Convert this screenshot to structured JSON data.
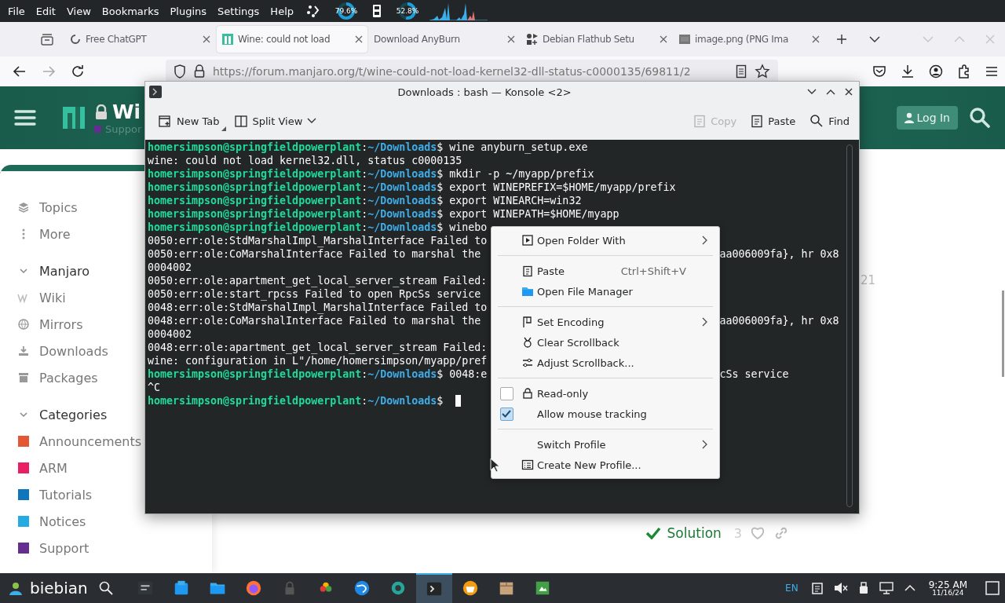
{
  "menubar": {
    "items": [
      "File",
      "Edit",
      "View",
      "Bookmarks",
      "Plugins",
      "Settings",
      "Help"
    ],
    "gauges": [
      {
        "reading": "79.6%",
        "level": 0.8
      },
      {
        "reading": "52.8%",
        "level": 0.53
      }
    ]
  },
  "browser": {
    "tabs": [
      {
        "title": "Free ChatGPT",
        "selected": false
      },
      {
        "title": "Wine: could not load",
        "selected": true
      },
      {
        "title": "Download AnyBurn",
        "selected": false
      },
      {
        "title": "Debian Flathub Setu",
        "selected": false
      },
      {
        "title": "image.png (PNG Ima",
        "selected": false
      }
    ],
    "forward_disabled": true,
    "url": "https://forum.manjaro.org/t/wine-could-not-load-kernel32-dll-status-c0000135/69811/2"
  },
  "page": {
    "title": "Wi",
    "subtitle": "Suppor",
    "login": "Log In",
    "top_items": [
      {
        "label": "Topics"
      },
      {
        "label": "More"
      }
    ],
    "sections": [
      {
        "label": "Manjaro",
        "expanded": true,
        "items": [
          {
            "label": "Wiki"
          },
          {
            "label": "Mirrors"
          },
          {
            "label": "Downloads"
          },
          {
            "label": "Packages"
          }
        ]
      },
      {
        "label": "Categories",
        "expanded": true,
        "items": [
          {
            "label": "Announcements",
            "color": "#e45735"
          },
          {
            "label": "ARM",
            "color": "#e91e63"
          },
          {
            "label": "Tutorials",
            "color": "#0e76bd"
          },
          {
            "label": "Notices",
            "color": "#25aae1"
          },
          {
            "label": "Support",
            "color": "#652d90"
          }
        ]
      }
    ],
    "date_fragment": "21",
    "solution": "Solution",
    "likes": "3"
  },
  "konsole": {
    "title": "Downloads : bash — Konsole <2>",
    "toolbar": [
      {
        "label": "New Tab",
        "disabled": false
      },
      {
        "label": "Split View",
        "disabled": false
      },
      {
        "label": "Copy",
        "disabled": true
      },
      {
        "label": "Paste",
        "disabled": false
      },
      {
        "label": "Find",
        "disabled": false
      }
    ],
    "lines": [
      {
        "kind": "prompt",
        "user": "homersimpson@springfieldpowerplant",
        "sep": ":",
        "path": "~/Downloads",
        "sigil": "$",
        "command": "wine anyburn_setup.exe",
        "cursor": false
      },
      {
        "kind": "output",
        "text": "wine: could not load kernel32.dll, status c0000135"
      },
      {
        "kind": "prompt",
        "user": "homersimpson@springfieldpowerplant",
        "sep": ":",
        "path": "~/Downloads",
        "sigil": "$",
        "command": "mkdir -p ~/myapp/prefix",
        "cursor": false
      },
      {
        "kind": "prompt",
        "user": "homersimpson@springfieldpowerplant",
        "sep": ":",
        "path": "~/Downloads",
        "sigil": "$",
        "command": "export WINEPREFIX=$HOME/myapp/prefix",
        "cursor": false
      },
      {
        "kind": "prompt",
        "user": "homersimpson@springfieldpowerplant",
        "sep": ":",
        "path": "~/Downloads",
        "sigil": "$",
        "command": "export WINEARCH=win32",
        "cursor": false
      },
      {
        "kind": "prompt",
        "user": "homersimpson@springfieldpowerplant",
        "sep": ":",
        "path": "~/Downloads",
        "sigil": "$",
        "command": "export WINEPATH=$HOME/myapp",
        "cursor": false
      },
      {
        "kind": "prompt",
        "user": "homersimpson@springfieldpowerplant",
        "sep": ":",
        "path": "~/Downloads",
        "sigil": "$",
        "command": "winebo",
        "cursor": false
      },
      {
        "kind": "output",
        "text": "0050:err:ole:StdMarshalImpl_MarshalInterface Failed to"
      },
      {
        "kind": "output",
        "text": "0050:err:ole:CoMarshalInterface Failed to marshal the",
        "tail": "aa006009fa}, hr 0x8"
      },
      {
        "kind": "output",
        "text": "0004002"
      },
      {
        "kind": "output",
        "text": "0050:err:ole:apartment_get_local_server_stream Failed:"
      },
      {
        "kind": "output",
        "text": "0050:err:ole:start_rpcss Failed to open RpcSs service"
      },
      {
        "kind": "output",
        "text": "0048:err:ole:StdMarshalImpl_MarshalInterface Failed to"
      },
      {
        "kind": "output",
        "text": "0048:err:ole:CoMarshalInterface Failed to marshal the",
        "tail": "aa006009fa}, hr 0x8"
      },
      {
        "kind": "output",
        "text": "0004002"
      },
      {
        "kind": "output",
        "text": "0048:err:ole:apartment_get_local_server_stream Failed:"
      },
      {
        "kind": "output",
        "text": "wine: configuration in L\"/home/homersimpson/myapp/pref"
      },
      {
        "kind": "prompt",
        "user": "homersimpson@springfieldpowerplant",
        "sep": ":",
        "path": "~/Downloads",
        "sigil": "$",
        "command": "0048:e",
        "tail": "cSs service",
        "cursor": false
      },
      {
        "kind": "output",
        "text": "^C"
      },
      {
        "kind": "prompt",
        "user": "homersimpson@springfieldpowerplant",
        "sep": ":",
        "path": "~/Downloads",
        "sigil": "$",
        "cursor": true
      }
    ]
  },
  "context_menu": {
    "items": [
      {
        "kind": "item",
        "label": "Open Folder With",
        "submenu": true
      },
      {
        "kind": "separator"
      },
      {
        "kind": "item",
        "label": "Paste",
        "shortcut": "Ctrl+Shift+V",
        "submenu": false
      },
      {
        "kind": "item",
        "label": "Open File Manager",
        "submenu": false
      },
      {
        "kind": "separator"
      },
      {
        "kind": "item",
        "label": "Set Encoding",
        "submenu": true
      },
      {
        "kind": "item",
        "label": "Clear Scrollback",
        "submenu": false
      },
      {
        "kind": "item",
        "label": "Adjust Scrollback...",
        "submenu": false
      },
      {
        "kind": "separator"
      },
      {
        "kind": "check",
        "label": "Read-only",
        "checked": false
      },
      {
        "kind": "check",
        "label": "Allow mouse tracking",
        "checked": true
      },
      {
        "kind": "separator"
      },
      {
        "kind": "item",
        "label": "Switch Profile",
        "submenu": true
      },
      {
        "kind": "item",
        "label": "Create New Profile...",
        "submenu": false
      }
    ]
  },
  "taskbar": {
    "start_label": "biebian",
    "apps": [
      {
        "active": false
      },
      {
        "active": false
      },
      {
        "active": false
      },
      {
        "active": false
      },
      {
        "active": false
      },
      {
        "active": false
      },
      {
        "active": false
      },
      {
        "active": false
      },
      {
        "active": true
      },
      {
        "active": false
      },
      {
        "active": false
      },
      {
        "active": false
      }
    ],
    "language": "EN",
    "time": "9:25 AM",
    "date": "11/16/24"
  }
}
